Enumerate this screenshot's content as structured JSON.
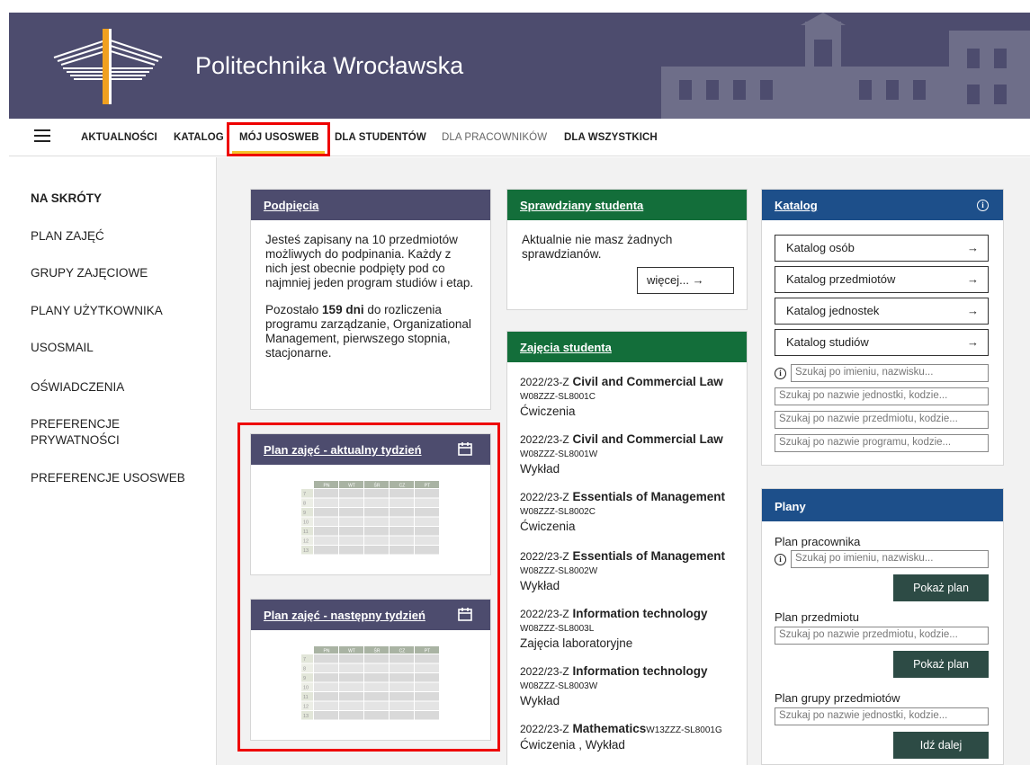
{
  "header": {
    "title": "Politechnika Wrocławska"
  },
  "nav": {
    "items": [
      "AKTUALNOŚCI",
      "KATALOG",
      "MÓJ USOSWEB",
      "DLA STUDENTÓW",
      "DLA PRACOWNIKÓW",
      "DLA WSZYSTKICH"
    ]
  },
  "sidebar": {
    "items": [
      "NA SKRÓTY",
      "PLAN ZAJĘĆ",
      "GRUPY ZAJĘCIOWE",
      "PLANY UŻYTKOWNIKA",
      "USOSMAIL",
      "OŚWIADCZENIA",
      "PREFERENCJE",
      "PRYWATNOŚCI",
      "PREFERENCJE USOSWEB"
    ]
  },
  "podpiecia": {
    "title": "Podpięcia",
    "text1": "Jesteś zapisany na 10 przedmiotów możliwych do podpinania. Każdy z nich jest obecnie podpięty pod co najmniej jeden program studiów i etap.",
    "text2_pre": "Pozostało ",
    "text2_bold": "159 dni",
    "text2_post": " do rozliczenia programu zarządzanie, Organizational Management, pierwszego stopnia, stacjonarne."
  },
  "plan_current": {
    "title": "Plan zajęć - aktualny tydzień"
  },
  "plan_next": {
    "title": "Plan zajęć - następny tydzień"
  },
  "mini_plan": {
    "days": [
      "PN",
      "WT",
      "ŚR",
      "CZ",
      "PT"
    ],
    "hours": [
      "7",
      "8",
      "9",
      "10",
      "11",
      "12",
      "13"
    ]
  },
  "sprawdziany": {
    "title": "Sprawdziany studenta",
    "text": "Aktualnie nie masz żadnych sprawdzianów.",
    "more": "więcej...",
    "arrow": "→"
  },
  "zajecia": {
    "title": "Zajęcia studenta",
    "courses": [
      {
        "sem": "2022/23-Z",
        "name": "Civil and Commercial Law",
        "code": "W08ZZZ-SL8001C",
        "type": "Ćwiczenia"
      },
      {
        "sem": "2022/23-Z",
        "name": "Civil and Commercial Law",
        "code": "W08ZZZ-SL8001W",
        "type": "Wykład"
      },
      {
        "sem": "2022/23-Z",
        "name": "Essentials of Management",
        "code": "W08ZZZ-SL8002C",
        "type": "Ćwiczenia"
      },
      {
        "sem": "2022/23-Z",
        "name": "Essentials of Management",
        "code": "W08ZZZ-SL8002W",
        "type": "Wykład"
      },
      {
        "sem": "2022/23-Z",
        "name": "Information technology",
        "code": "W08ZZZ-SL8003L",
        "type": "Zajęcia laboratoryjne"
      },
      {
        "sem": "2022/23-Z",
        "name": "Information technology",
        "code": "W08ZZZ-SL8003W",
        "type": "Wykład"
      },
      {
        "sem": "2022/23-Z",
        "name": "Mathematics",
        "code": "W13ZZZ-SL8001G",
        "type": "Ćwiczenia , Wykład",
        "code_inline": "W13ZZZ-"
      }
    ]
  },
  "katalog": {
    "title": "Katalog",
    "buttons": [
      "Katalog osób",
      "Katalog przedmiotów",
      "Katalog jednostek",
      "Katalog studiów"
    ],
    "arrow": "→",
    "search_person": "Szukaj po imieniu, nazwisku...",
    "search_unit": "Szukaj po nazwie jednostki, kodzie...",
    "search_course": "Szukaj po nazwie przedmiotu, kodzie...",
    "search_program": "Szukaj po nazwie programu, kodzie..."
  },
  "plany": {
    "title": "Plany",
    "employee_label": "Plan pracownika",
    "employee_placeholder": "Szukaj po imieniu, nazwisku...",
    "show_plan": "Pokaż plan",
    "course_label": "Plan przedmiotu",
    "course_placeholder": "Szukaj po nazwie przedmiotu, kodzie...",
    "group_label": "Plan grupy przedmiotów",
    "group_placeholder": "Szukaj po nazwie jednostki, kodzie...",
    "go_next": "Idź dalej"
  }
}
